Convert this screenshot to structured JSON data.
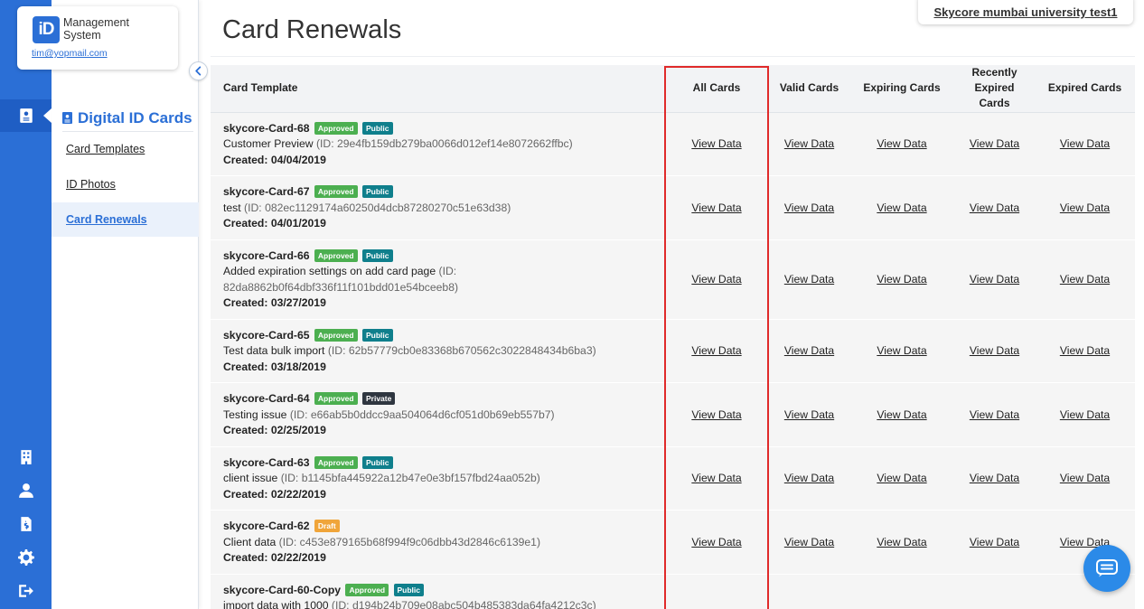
{
  "brand": {
    "logo_text": "iD",
    "name_line1": "Management",
    "name_line2": "System",
    "email": "tim@yopmail.com"
  },
  "rail": {
    "items": [
      {
        "icon": "id-card-icon",
        "active": true
      },
      {
        "icon": "building-icon"
      },
      {
        "icon": "user-icon"
      },
      {
        "icon": "document-dollar-icon"
      },
      {
        "icon": "gear-icon"
      },
      {
        "icon": "sign-out-icon"
      }
    ]
  },
  "sidebar": {
    "section_title": "Digital ID Cards",
    "items": [
      {
        "label": "Card Templates"
      },
      {
        "label": "ID Photos"
      },
      {
        "label": "Card Renewals",
        "active": true
      }
    ]
  },
  "header": {
    "title": "Card Renewals",
    "organization": "Skycore mumbai university test1"
  },
  "table": {
    "columns": [
      "Card Template",
      "All Cards",
      "Valid Cards",
      "Expiring Cards",
      "Recently Expired Cards",
      "Expired Cards"
    ],
    "link_label": "View Data",
    "created_prefix": "Created:",
    "rows": [
      {
        "name": "skycore-Card-68",
        "badges": [
          [
            "Approved",
            "approved"
          ],
          [
            "Public",
            "public"
          ]
        ],
        "desc": "Customer Preview",
        "id": "(ID: 29e4fb159db279ba0066d012ef14e8072662ffbc)",
        "created": "04/04/2019"
      },
      {
        "name": "skycore-Card-67",
        "badges": [
          [
            "Approved",
            "approved"
          ],
          [
            "Public",
            "public"
          ]
        ],
        "desc": "test",
        "id": "(ID: 082ec1129174a60250d4dcb87280270c51e63d38)",
        "created": "04/01/2019"
      },
      {
        "name": "skycore-Card-66",
        "badges": [
          [
            "Approved",
            "approved"
          ],
          [
            "Public",
            "public"
          ]
        ],
        "desc": "Added expiration settings on add card page",
        "id": "(ID: 82da8862b0f64dbf336f11f101bdd01e54bceeb8)",
        "created": "03/27/2019"
      },
      {
        "name": "skycore-Card-65",
        "badges": [
          [
            "Approved",
            "approved"
          ],
          [
            "Public",
            "public"
          ]
        ],
        "desc": "Test data bulk import",
        "id": "(ID: 62b57779cb0e83368b670562c3022848434b6ba3)",
        "created": "03/18/2019"
      },
      {
        "name": "skycore-Card-64",
        "badges": [
          [
            "Approved",
            "approved"
          ],
          [
            "Private",
            "private"
          ]
        ],
        "desc": "Testing issue",
        "id": "(ID: e66ab5b0ddcc9aa504064d6cf051d0b69eb557b7)",
        "created": "02/25/2019"
      },
      {
        "name": "skycore-Card-63",
        "badges": [
          [
            "Approved",
            "approved"
          ],
          [
            "Public",
            "public"
          ]
        ],
        "desc": "client issue",
        "id": "(ID: b1145bfa445922a12b47e0e3bf157fbd24aa052b)",
        "created": "02/22/2019"
      },
      {
        "name": "skycore-Card-62",
        "badges": [
          [
            "Draft",
            "draft"
          ]
        ],
        "desc": "Client data",
        "id": "(ID: c453e879165b68f994f9c06dbb43d2846c6139e1)",
        "created": "02/22/2019"
      },
      {
        "name": "skycore-Card-60-Copy",
        "badges": [
          [
            "Approved",
            "approved"
          ],
          [
            "Public",
            "public"
          ]
        ],
        "desc": "import data with 1000",
        "id": "(ID: d194b24b709e08abc504b485383da64fa4212c3c)",
        "created": ""
      }
    ]
  },
  "colors": {
    "primary": "#2b6fd6",
    "highlight": "#e02a2a",
    "approved": "#4caf50",
    "public": "#0f7f8c",
    "private": "#2f3640",
    "draft": "#f0a53a"
  }
}
